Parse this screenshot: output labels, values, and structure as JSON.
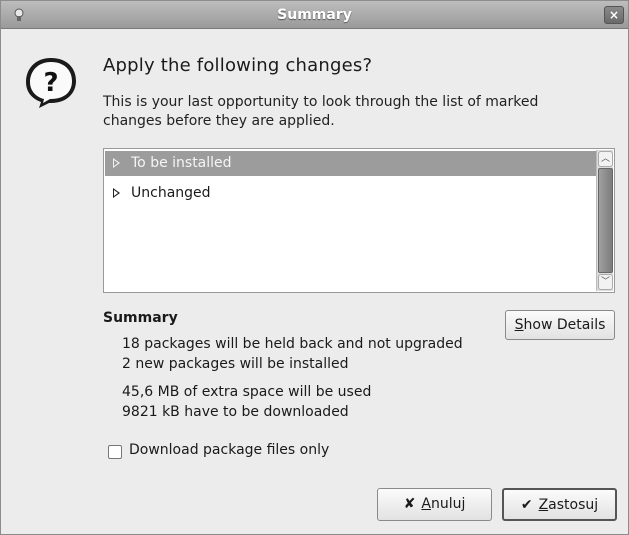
{
  "window": {
    "title": "Summary",
    "close_glyph": "×",
    "icon": "package-manager-icon"
  },
  "dialog": {
    "icon": "question-icon",
    "icon_glyph": "?",
    "heading": "Apply the following changes?",
    "description": "This is your last opportunity to look through the list of marked changes before they are applied."
  },
  "changes_list": {
    "rows": [
      {
        "label": "To be installed",
        "selected": true
      },
      {
        "label": "Unchanged",
        "selected": false
      }
    ]
  },
  "summary": {
    "label": "Summary",
    "lines": [
      "18 packages will be held back and not upgraded",
      "2 new packages will be installed",
      "45,6 MB of extra space will be used",
      "9821 kB have to be downloaded"
    ],
    "show_details": {
      "mnemonic": "S",
      "rest": "how Details"
    }
  },
  "download_only": {
    "label": "Download package files only",
    "checked": false
  },
  "buttons": {
    "cancel": {
      "mnemonic": "A",
      "rest": "nuluj",
      "icon": "cancel-x-icon",
      "glyph": "✘"
    },
    "apply": {
      "mnemonic": "Z",
      "rest": "astosuj",
      "icon": "apply-check-icon",
      "glyph": "✔"
    }
  }
}
